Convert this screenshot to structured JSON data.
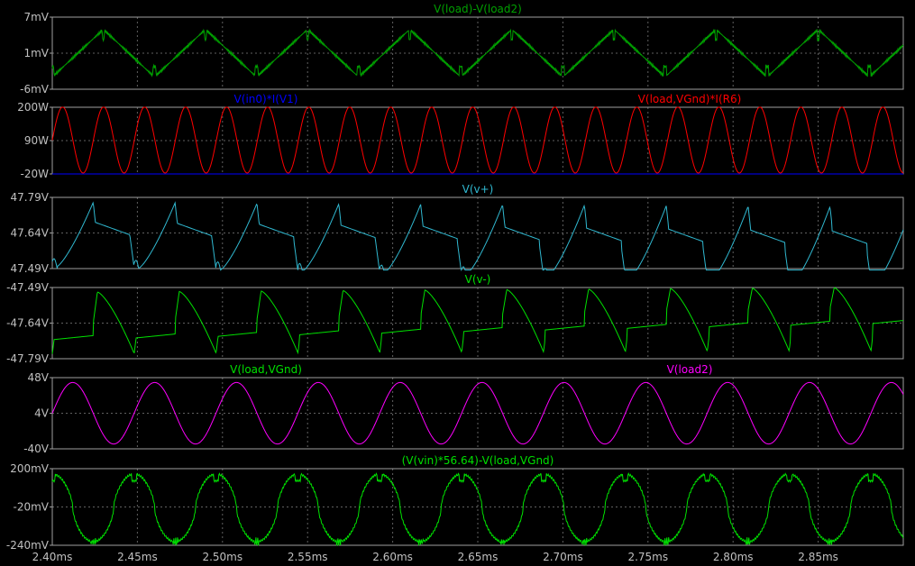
{
  "chart_data": [
    {
      "type": "line",
      "title": "V(load)-V(load2)",
      "yticks": [
        "7mV",
        "1mV",
        "-6mV"
      ],
      "ylim": [
        -6,
        7
      ],
      "series": [
        {
          "name": "V(load)-V(load2)",
          "color": "#00a000",
          "wave": {
            "kind": "tri",
            "period": 0.06,
            "phase": 0.0,
            "amp": 4.3,
            "offset": 0.5,
            "spike": 1.8
          }
        }
      ]
    },
    {
      "type": "line",
      "titles": [
        {
          "text": "V(in0)*I(V1)",
          "color": "#0000ff",
          "align": "left"
        },
        {
          "text": "V(load,VGnd)*I(R6)",
          "color": "#ff0000",
          "align": "right"
        }
      ],
      "yticks": [
        "200W",
        "90W",
        "-20W"
      ],
      "ylim": [
        -20,
        200
      ],
      "series": [
        {
          "name": "V(in0)*I(V1)",
          "color": "#0000ff",
          "wave": {
            "kind": "flat",
            "value": -20
          }
        },
        {
          "name": "V(load,VGnd)*I(R6)",
          "color": "#ff0000",
          "wave": {
            "kind": "sinsq",
            "period": 0.0241,
            "phase": 0.006,
            "amp": 218,
            "offset": -17
          }
        }
      ]
    },
    {
      "type": "line",
      "title": "V(v+)",
      "yticks": [
        "47.79V",
        "47.64V",
        "47.49V"
      ],
      "ylim": [
        47.49,
        47.79
      ],
      "series": [
        {
          "name": "V(v+)",
          "color": "#30b8d0",
          "wave": {
            "kind": "ripple_up",
            "period": 0.0481,
            "phase": 0.0,
            "hi": 47.77,
            "lo": 47.5,
            "plateau_start": 47.69,
            "plateau_end": 47.63,
            "drift": -0.07
          }
        }
      ]
    },
    {
      "type": "line",
      "title": "V(v-)",
      "yticks": [
        "-47.49V",
        "-47.64V",
        "-47.79V"
      ],
      "ylim": [
        -47.79,
        -47.49
      ],
      "series": [
        {
          "name": "V(v-)",
          "color": "#00e000",
          "wave": {
            "kind": "ripple_down",
            "period": 0.0481,
            "phase": 0.024,
            "hi": -47.51,
            "lo": -47.77,
            "plateau_start": -47.71,
            "plateau_end": -47.64,
            "drift": 0.07
          }
        }
      ]
    },
    {
      "type": "line",
      "titles": [
        {
          "text": "V(load,VGnd)",
          "color": "#00e000",
          "align": "left"
        },
        {
          "text": "V(load2)",
          "color": "#ff00ff",
          "align": "right"
        }
      ],
      "yticks": [
        "48V",
        "4V",
        "-40V"
      ],
      "ylim": [
        -40,
        48
      ],
      "series": [
        {
          "name": "V(load2)",
          "color": "#ff00ff",
          "wave": {
            "kind": "sin",
            "period": 0.0481,
            "phase": 0.0,
            "amp": 38,
            "offset": 4
          }
        }
      ]
    },
    {
      "type": "line",
      "title": "(V(vin)*56.64)-V(load,VGnd)",
      "yticks": [
        "200mV",
        "-20mV",
        "-240mV"
      ],
      "ylim": [
        -240,
        200
      ],
      "series": [
        {
          "name": "(V(vin)*56.64)-V(load,VGnd)",
          "color": "#00e000",
          "wave": {
            "kind": "error",
            "period": 0.0481,
            "phase": 0.0,
            "hi": 170,
            "lo": -220
          }
        }
      ]
    }
  ],
  "xaxis": {
    "xlim": [
      2.4,
      2.9
    ],
    "ticks": [
      "2.40ms",
      "2.45ms",
      "2.50ms",
      "2.55ms",
      "2.60ms",
      "2.65ms",
      "2.70ms",
      "2.75ms",
      "2.80ms",
      "2.85ms"
    ],
    "tick_values": [
      2.4,
      2.45,
      2.5,
      2.55,
      2.6,
      2.65,
      2.7,
      2.75,
      2.8,
      2.85
    ],
    "grid": true
  },
  "colors": {
    "background": "#000000",
    "frame": "#a0a0a0",
    "grid": "#606060",
    "axis_text": "#c0c0c0"
  }
}
